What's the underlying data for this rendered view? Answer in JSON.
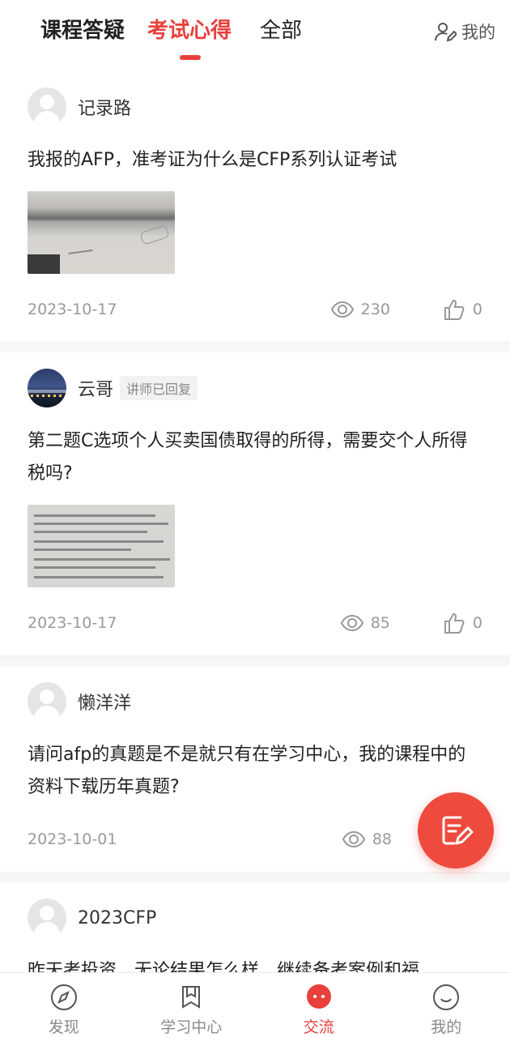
{
  "header": {
    "tabs": [
      {
        "label": "课程答疑",
        "active": false
      },
      {
        "label": "考试心得",
        "active": true
      },
      {
        "label": "全部",
        "active": false
      }
    ],
    "mine_label": "我的"
  },
  "posts": [
    {
      "author": "记录路",
      "avatar": "default-avatar",
      "badge": "",
      "text": "我报的AFP，准考证为什么是CFP系列认证考试",
      "has_image": true,
      "date": "2023-10-17",
      "views": "230",
      "likes": "0"
    },
    {
      "author": "云哥",
      "avatar": "photo-avatar",
      "badge": "讲师已回复",
      "text": "第二题C选项个人买卖国债取得的所得，需要交个人所得税吗?",
      "has_image": true,
      "date": "2023-10-17",
      "views": "85",
      "likes": "0"
    },
    {
      "author": "懒洋洋",
      "avatar": "default-avatar",
      "badge": "",
      "text": "请问afp的真题是不是就只有在学习中心，我的课程中的资料下载历年真题?",
      "has_image": false,
      "date": "2023-10-01",
      "views": "88",
      "likes": ""
    },
    {
      "author": "2023CFP",
      "avatar": "default-avatar",
      "badge": "",
      "text": "昨天考投资，无论结果怎么样，继续备考案例和福",
      "has_image": false,
      "date": "",
      "views": "",
      "likes": ""
    }
  ],
  "fab": {
    "icon": "compose-icon"
  },
  "bottom_nav": [
    {
      "label": "发现",
      "icon": "compass-icon",
      "active": false
    },
    {
      "label": "学习中心",
      "icon": "bookmark-book-icon",
      "active": false
    },
    {
      "label": "交流",
      "icon": "chat-bubble-icon",
      "active": true
    },
    {
      "label": "我的",
      "icon": "smile-face-icon",
      "active": false
    }
  ],
  "colors": {
    "accent": "#e8403c",
    "muted": "#999999"
  }
}
